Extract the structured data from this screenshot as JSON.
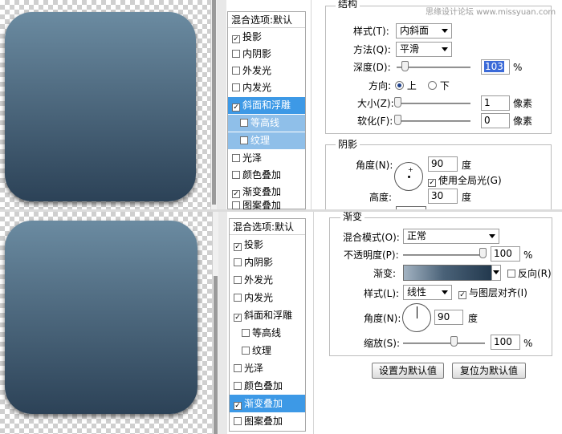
{
  "watermark": "思缘设计论坛 www.missyuan.com",
  "top_panel": {
    "list_header": "混合选项:默认",
    "styles": [
      {
        "label": "投影",
        "checked": true
      },
      {
        "label": "内阴影",
        "checked": false
      },
      {
        "label": "外发光",
        "checked": false
      },
      {
        "label": "内发光",
        "checked": false
      },
      {
        "label": "斜面和浮雕",
        "checked": true
      },
      {
        "label": "等高线",
        "checked": false
      },
      {
        "label": "纹理",
        "checked": false
      },
      {
        "label": "光泽",
        "checked": false
      },
      {
        "label": "颜色叠加",
        "checked": false
      },
      {
        "label": "渐变叠加",
        "checked": true
      },
      {
        "label": "图案叠加",
        "checked": false
      }
    ],
    "structure": {
      "title": "结构",
      "style_label": "样式(T):",
      "style_value": "内斜面",
      "technique_label": "方法(Q):",
      "technique_value": "平滑",
      "depth_label": "深度(D):",
      "depth_value": "103",
      "depth_unit": "%",
      "direction_label": "方向:",
      "dir_up": "上",
      "dir_down": "下",
      "size_label": "大小(Z):",
      "size_value": "1",
      "size_unit": "像素",
      "soften_label": "软化(F):",
      "soften_value": "0",
      "soften_unit": "像素"
    },
    "shading": {
      "title": "阴影",
      "angle_label": "角度(N):",
      "angle_value": "90",
      "angle_unit": "度",
      "global_light_label": "使用全局光(G)",
      "altitude_label": "高度:",
      "altitude_value": "30",
      "altitude_unit": "度"
    }
  },
  "bottom_panel": {
    "list_header": "混合选项:默认",
    "styles": [
      {
        "label": "投影",
        "checked": true
      },
      {
        "label": "内阴影",
        "checked": false
      },
      {
        "label": "外发光",
        "checked": false
      },
      {
        "label": "内发光",
        "checked": false
      },
      {
        "label": "斜面和浮雕",
        "checked": true
      },
      {
        "label": "等高线",
        "checked": false
      },
      {
        "label": "纹理",
        "checked": false
      },
      {
        "label": "光泽",
        "checked": false
      },
      {
        "label": "颜色叠加",
        "checked": false
      },
      {
        "label": "渐变叠加",
        "checked": true
      },
      {
        "label": "图案叠加",
        "checked": false
      }
    ],
    "gradient": {
      "title": "渐变",
      "blend_label": "混合模式(O):",
      "blend_value": "正常",
      "opacity_label": "不透明度(P):",
      "opacity_value": "100",
      "opacity_unit": "%",
      "gradient_label": "渐变:",
      "reverse_label": "反向(R)",
      "style_label": "样式(L):",
      "style_value": "线性",
      "align_label": "与图层对齐(I)",
      "angle_label": "角度(N):",
      "angle_value": "90",
      "angle_unit": "度",
      "scale_label": "缩放(S):",
      "scale_value": "100",
      "scale_unit": "%",
      "make_default_label": "设置为默认值",
      "reset_default_label": "复位为默认值"
    }
  },
  "colors": {
    "selection": "#3d99e6",
    "tile_top": "#6b8ba1",
    "tile_bottom": "#2c4257"
  }
}
